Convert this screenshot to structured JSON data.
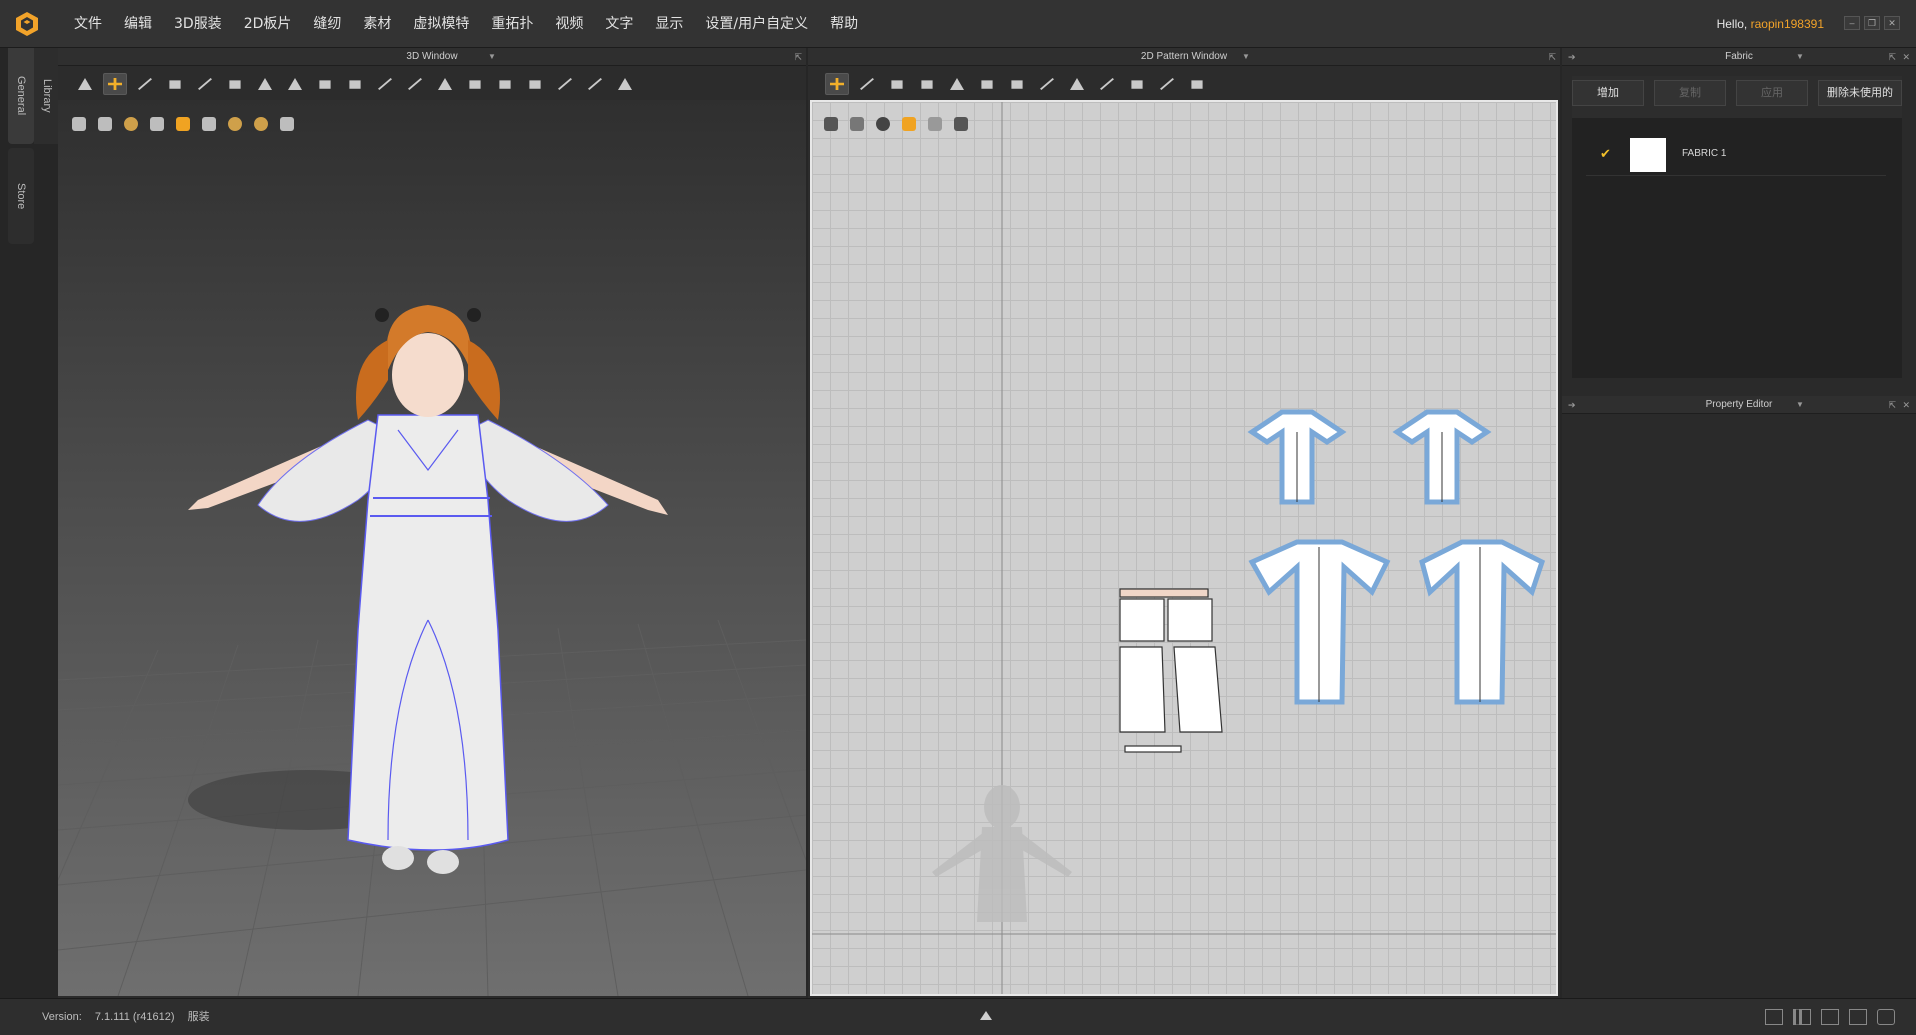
{
  "menu": {
    "items": [
      "文件",
      "编辑",
      "3D服装",
      "2D板片",
      "缝纫",
      "素材",
      "虚拟模特",
      "重拓扑",
      "视频",
      "文字",
      "显示",
      "设置/用户自定义",
      "帮助"
    ]
  },
  "user": {
    "greeting": "Hello,",
    "username": "raopin198391"
  },
  "side_tabs": {
    "general": "General",
    "library": "Library",
    "store": "Store"
  },
  "window3d": {
    "title": "3D Window"
  },
  "window2d": {
    "title": "2D Pattern Window"
  },
  "fabric": {
    "title": "Fabric",
    "buttons": {
      "add": "增加",
      "copy": "复制",
      "apply": "应用",
      "delete_unused": "删除未使用的"
    },
    "items": [
      {
        "name": "FABRIC 1",
        "swatch_color": "#ffffff"
      }
    ]
  },
  "property_editor": {
    "title": "Property Editor"
  },
  "status": {
    "version_label": "Version:",
    "version": "7.1.111 (r41612)",
    "mode": "服装"
  },
  "colors": {
    "accent": "#f2a32a",
    "pattern_outline": "#7aa8d8",
    "seam_line": "#5a5af0"
  }
}
